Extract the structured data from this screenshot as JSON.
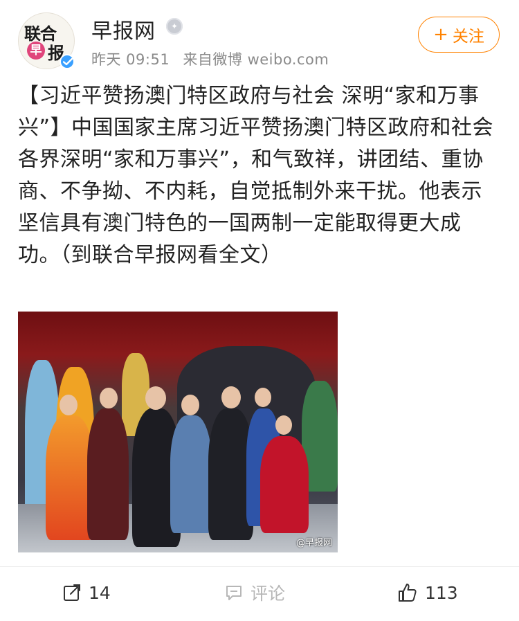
{
  "header": {
    "avatar_text_top": "联合",
    "avatar_badge": "早",
    "avatar_text_bottom": "报",
    "account_name": "早报网",
    "medal_icon": "medal-icon",
    "meta": {
      "time": "昨天 09:51",
      "source": "来自微博 weibo.com"
    },
    "follow_label": "关注",
    "follow_plus": "+"
  },
  "post": {
    "text": "【习近平赞扬澳门特区政府与社会 深明“家和万事兴”】中国国家主席习近平赞扬澳门特区政府和社会各界深明“家和万事兴”，和气致祥，讲团结、重协商、不争拗、不内耗，自觉抵制外来干扰。他表示坚信具有澳门特色的一国两制一定能取得更大成功。（到联合早报网看全文）",
    "image_watermark": "@早报网"
  },
  "actions": {
    "repost_count": "14",
    "comment_label": "评论",
    "like_count": "113"
  },
  "colors": {
    "accent": "#ff8200",
    "verified": "#3aa0ff",
    "text": "#222222",
    "meta": "#8a8a8a"
  }
}
